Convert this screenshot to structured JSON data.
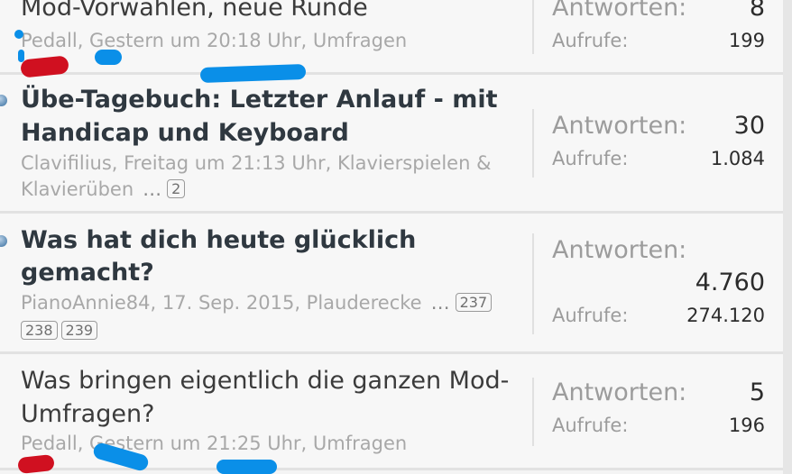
{
  "threads": [
    {
      "title": "Mod-Vorwahlen, neue Runde",
      "meta": "Pedall, Gestern um 20:18 Uhr, Umfragen",
      "replies_label": "Antworten:",
      "replies": "8",
      "views_label": "Aufrufe:",
      "views": "199"
    },
    {
      "title": "Übe-Tagebuch: Letzter Anlauf - mit Handicap und Keyboard",
      "title_line1": "Übe-Tagebuch: Letzter Anlauf - mit",
      "title_line2": "Handicap und Keyboard",
      "meta_line1": "Clavifilius, Freitag um 21:13 Uhr, Klavierspielen &",
      "meta_line2": "Klavierüben",
      "ellipsis": "…",
      "pages": [
        "2"
      ],
      "replies_label": "Antworten:",
      "replies": "30",
      "views_label": "Aufrufe:",
      "views": "1.084"
    },
    {
      "title_line1": "Was hat dich heute glücklich",
      "title_line2": "gemacht?",
      "meta_line1": "PianoAnnie84, 17. Sep. 2015, Plauderecke",
      "ellipsis": "…",
      "pages": [
        "237",
        "238",
        "239"
      ],
      "replies_label": "Antworten:",
      "replies": "4.760",
      "views_label": "Aufrufe:",
      "views": "274.120"
    },
    {
      "title_line1": "Was bringen eigentlich die ganzen Mod-",
      "title_line2": "Umfragen?",
      "meta": "Pedall, Gestern um 21:25 Uhr, Umfragen",
      "replies_label": "Antworten:",
      "replies": "5",
      "views_label": "Aufrufe:",
      "views": "196"
    }
  ],
  "colors": {
    "redaction_blue": "#0a8fe8",
    "redaction_red": "#d01020",
    "unread_dot": "#5d8bb4"
  }
}
